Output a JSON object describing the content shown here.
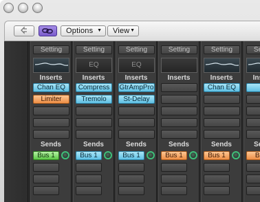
{
  "toolbar": {
    "back_icon": "back-arrow-icon",
    "link_icon": "link-chain-icon",
    "link_color": "#8b6fd6",
    "options_label": "Options",
    "view_label": "View"
  },
  "labels": {
    "setting": "Setting",
    "eq": "EQ",
    "inserts": "Inserts",
    "sends": "Sends"
  },
  "colors": {
    "insert_blue": "#6cc8ea",
    "insert_orange": "#f19a52",
    "send_green": "#63c94c",
    "send_blue": "#6cc8ea",
    "send_orange": "#f19a52"
  },
  "strips": [
    {
      "eq": "curve",
      "inserts": [
        {
          "label": "Chan EQ",
          "color": "blue"
        },
        {
          "label": "Limiter",
          "color": "orange"
        }
      ],
      "send": {
        "label": "Bus 1",
        "color": "green"
      }
    },
    {
      "eq": "text",
      "inserts": [
        {
          "label": "Compress",
          "color": "blue"
        },
        {
          "label": "Tremolo",
          "color": "blue"
        }
      ],
      "send": {
        "label": "Bus 1",
        "color": "blue"
      }
    },
    {
      "eq": "text",
      "inserts": [
        {
          "label": "GtrAmpPro",
          "color": "blue"
        },
        {
          "label": "St-Delay",
          "color": "blue"
        }
      ],
      "send": {
        "label": "Bus 1",
        "color": "blue"
      }
    },
    {
      "eq": "empty",
      "inserts": [],
      "send": {
        "label": "Bus 1",
        "color": "orange"
      }
    },
    {
      "eq": "curve",
      "inserts": [
        {
          "label": "Chan EQ",
          "color": "blue"
        }
      ],
      "send": {
        "label": "Bus 1",
        "color": "orange"
      }
    },
    {
      "eq": "curve",
      "inserts": [
        {
          "label": "Ch",
          "color": "blue"
        }
      ],
      "send": {
        "label": "Bu",
        "color": "orange"
      }
    }
  ]
}
